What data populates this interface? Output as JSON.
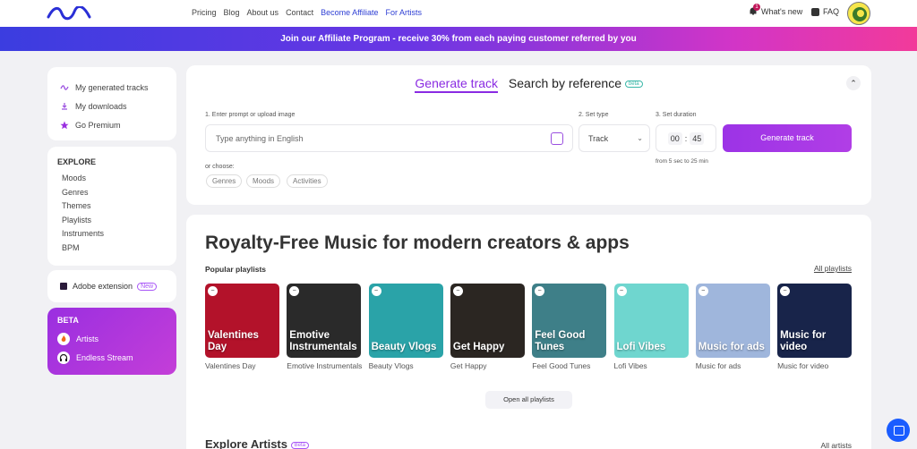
{
  "nav": {
    "links": [
      "Pricing",
      "Blog",
      "About us",
      "Contact",
      "Become Affiliate",
      "For Artists"
    ],
    "whats_new": "What's new",
    "notif_count": "1",
    "faq": "FAQ"
  },
  "banner": {
    "text": "Join our Affiliate Program - receive 30% from each paying customer referred by you"
  },
  "sidebar": {
    "top_items": [
      "My generated tracks",
      "My downloads",
      "Go Premium"
    ],
    "explore_title": "EXPLORE",
    "explore_items": [
      "Moods",
      "Genres",
      "Themes",
      "Playlists",
      "Instruments",
      "BPM"
    ],
    "extension": "Adobe extension",
    "extension_badge": "New",
    "beta_title": "BETA",
    "beta_items": [
      "Artists",
      "Endless Stream"
    ]
  },
  "generate": {
    "tab_active": "Generate track",
    "tab_other": "Search by reference",
    "tab_other_badge": "beta",
    "label_prompt": "1. Enter prompt or upload image",
    "label_type": "2. Set type",
    "label_duration": "3. Set duration",
    "prompt_placeholder": "Type anything in English",
    "type_value": "Track",
    "duration_min": "00",
    "duration_sec": "45",
    "duration_hint": "from 5 sec to 25 min",
    "button": "Generate track",
    "or_choose": "or choose:",
    "chips": [
      "Genres",
      "Moods",
      "Activities"
    ]
  },
  "main": {
    "heading": "Royalty-Free Music for modern creators & apps",
    "popular_label": "Popular playlists",
    "all_playlists": "All playlists",
    "playlists": [
      {
        "title": "Valentines Day",
        "caption": "Valentines Day",
        "color": "#b3122a"
      },
      {
        "title": "Emotive Instrumentals",
        "caption": "Emotive Instrumentals",
        "color": "#2a2a2a"
      },
      {
        "title": "Beauty Vlogs",
        "caption": "Beauty Vlogs",
        "color": "#2aa3a8"
      },
      {
        "title": "Get Happy",
        "caption": "Get Happy",
        "color": "#2b2622"
      },
      {
        "title": "Feel Good Tunes",
        "caption": "Feel Good Tunes",
        "color": "#3e7f88"
      },
      {
        "title": "Lofi Vibes",
        "caption": "Lofi Vibes",
        "color": "#6fd6cf"
      },
      {
        "title": "Music for ads",
        "caption": "Music for ads",
        "color": "#9fb6dc"
      },
      {
        "title": "Music for video",
        "caption": "Music for video",
        "color": "#18244a"
      }
    ],
    "open_all": "Open all playlists",
    "explore_artists": "Explore Artists",
    "explore_badge": "Beta",
    "all_artists": "All artists"
  }
}
